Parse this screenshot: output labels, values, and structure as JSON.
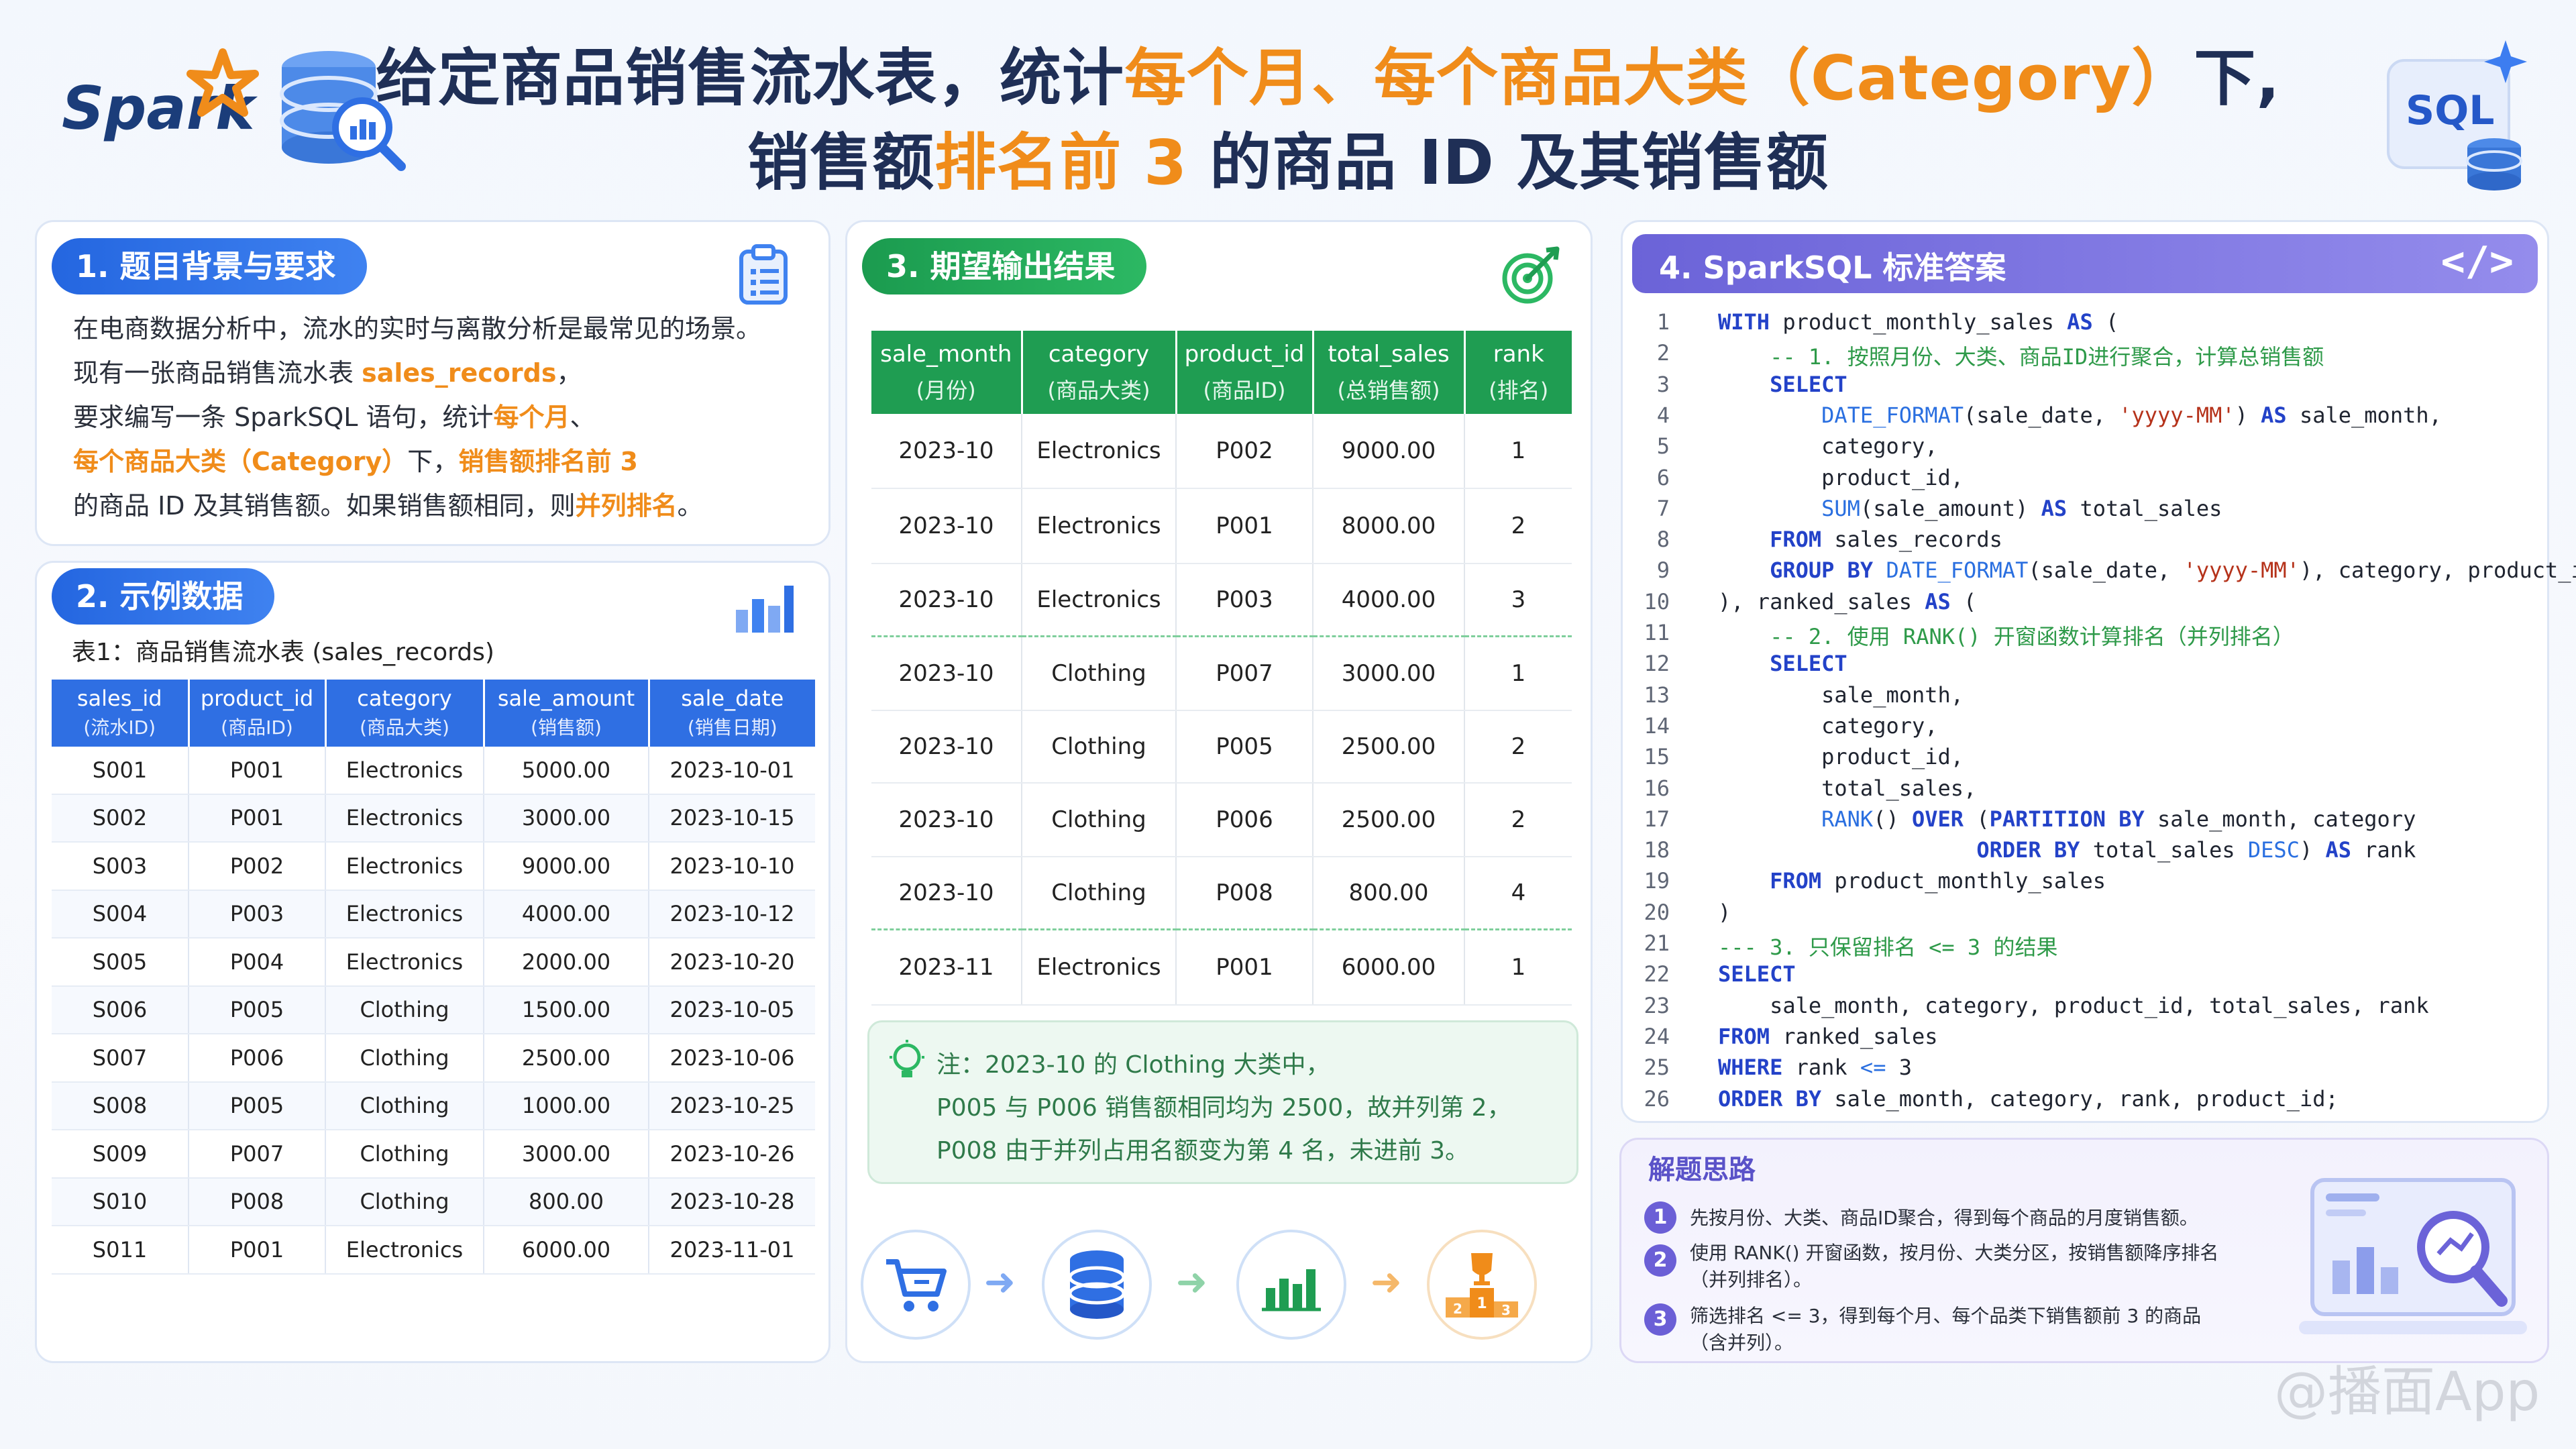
{
  "header": {
    "logo": "Spark",
    "title_line1": {
      "a": "给定商品销售流水表，统计",
      "b": "每个月、每个商品大类（Category）",
      "c": "下,"
    },
    "title_line2": {
      "a": "销售额",
      "b": "排名前 3",
      "c": " 的商品 ID 及其销售额"
    },
    "sql_badge": "SQL"
  },
  "section1": {
    "title": "1. 题目背景与要求",
    "line1": "在电商数据分析中，流水的实时与离散分析是最常见的场景。",
    "line2a": "现有一张商品销售流水表 ",
    "line2b": "sales_records",
    "line2c": "，",
    "line3a": "要求编写一条 SparkSQL 语句，统计",
    "line3b": "每个月",
    "line3c": "、",
    "line4a": "每个商品大类（Category）",
    "line4b": "下，",
    "line4c": "销售额排名前 3",
    "line5a": "的商品 ID 及其销售额。如果销售额相同，则",
    "line5b": "并列排名",
    "line5c": "。"
  },
  "section2": {
    "title": "2. 示例数据",
    "caption": "表1：商品销售流水表 (sales_records)",
    "headers": [
      {
        "name": "sales_id",
        "sub": "(流水ID)"
      },
      {
        "name": "product_id",
        "sub": "(商品ID)"
      },
      {
        "name": "category",
        "sub": "(商品大类)"
      },
      {
        "name": "sale_amount",
        "sub": "(销售额)"
      },
      {
        "name": "sale_date",
        "sub": "(销售日期)"
      }
    ],
    "rows": [
      [
        "S001",
        "P001",
        "Electronics",
        "5000.00",
        "2023-10-01"
      ],
      [
        "S002",
        "P001",
        "Electronics",
        "3000.00",
        "2023-10-15"
      ],
      [
        "S003",
        "P002",
        "Electronics",
        "9000.00",
        "2023-10-10"
      ],
      [
        "S004",
        "P003",
        "Electronics",
        "4000.00",
        "2023-10-12"
      ],
      [
        "S005",
        "P004",
        "Electronics",
        "2000.00",
        "2023-10-20"
      ],
      [
        "S006",
        "P005",
        "Clothing",
        "1500.00",
        "2023-10-05"
      ],
      [
        "S007",
        "P006",
        "Clothing",
        "2500.00",
        "2023-10-06"
      ],
      [
        "S008",
        "P005",
        "Clothing",
        "1000.00",
        "2023-10-25"
      ],
      [
        "S009",
        "P007",
        "Clothing",
        "3000.00",
        "2023-10-26"
      ],
      [
        "S010",
        "P008",
        "Clothing",
        "800.00",
        "2023-10-28"
      ],
      [
        "S011",
        "P001",
        "Electronics",
        "6000.00",
        "2023-11-01"
      ]
    ]
  },
  "section3": {
    "title": "3. 期望输出结果",
    "headers": [
      {
        "name": "sale_month",
        "sub": "(月份)"
      },
      {
        "name": "category",
        "sub": "(商品大类)"
      },
      {
        "name": "product_id",
        "sub": "(商品ID)"
      },
      {
        "name": "total_sales",
        "sub": "(总销售额)"
      },
      {
        "name": "rank",
        "sub": "(排名)"
      }
    ],
    "rows": [
      [
        "2023-10",
        "Electronics",
        "P002",
        "9000.00",
        "1"
      ],
      [
        "2023-10",
        "Electronics",
        "P001",
        "8000.00",
        "2"
      ],
      [
        "2023-10",
        "Electronics",
        "P003",
        "4000.00",
        "3"
      ],
      [
        "2023-10",
        "Clothing",
        "P007",
        "3000.00",
        "1"
      ],
      [
        "2023-10",
        "Clothing",
        "P005",
        "2500.00",
        "2"
      ],
      [
        "2023-10",
        "Clothing",
        "P006",
        "2500.00",
        "2"
      ],
      [
        "2023-10",
        "Clothing",
        "P008",
        "800.00",
        "4"
      ],
      [
        "2023-11",
        "Electronics",
        "P001",
        "6000.00",
        "1"
      ]
    ],
    "note1": "注：2023-10 的 Clothing 大类中，",
    "note2": "P005 与 P006 销售额相同均为 2500，故并列第 2，",
    "note3": "P008 由于并列占用名额变为第 4 名，未进前 3。"
  },
  "section4": {
    "title": "4. SparkSQL 标准答案",
    "code_icon": "</>"
  },
  "solution": {
    "title": "解题思路",
    "steps": [
      {
        "num": "1",
        "text": "先按月份、大类、商品ID聚合，得到每个商品的月度销售额。"
      },
      {
        "num": "2",
        "text1": "使用 RANK() 开窗函数，按月份、大类分区，按销售额降序排名",
        "text2": "（并列排名）。"
      },
      {
        "num": "3",
        "text1": "筛选排名 <= 3，得到每个月、每个品类下销售额前 3 的商品",
        "text2": "（含并列）。"
      }
    ]
  },
  "trophy_labels": [
    "2",
    "1",
    "3"
  ],
  "watermark": "@播面App",
  "colors": {
    "accent_orange": "#f08c1a",
    "blue": "#2f6fe3",
    "green": "#1f9d52",
    "purple": "#6b63d8"
  }
}
